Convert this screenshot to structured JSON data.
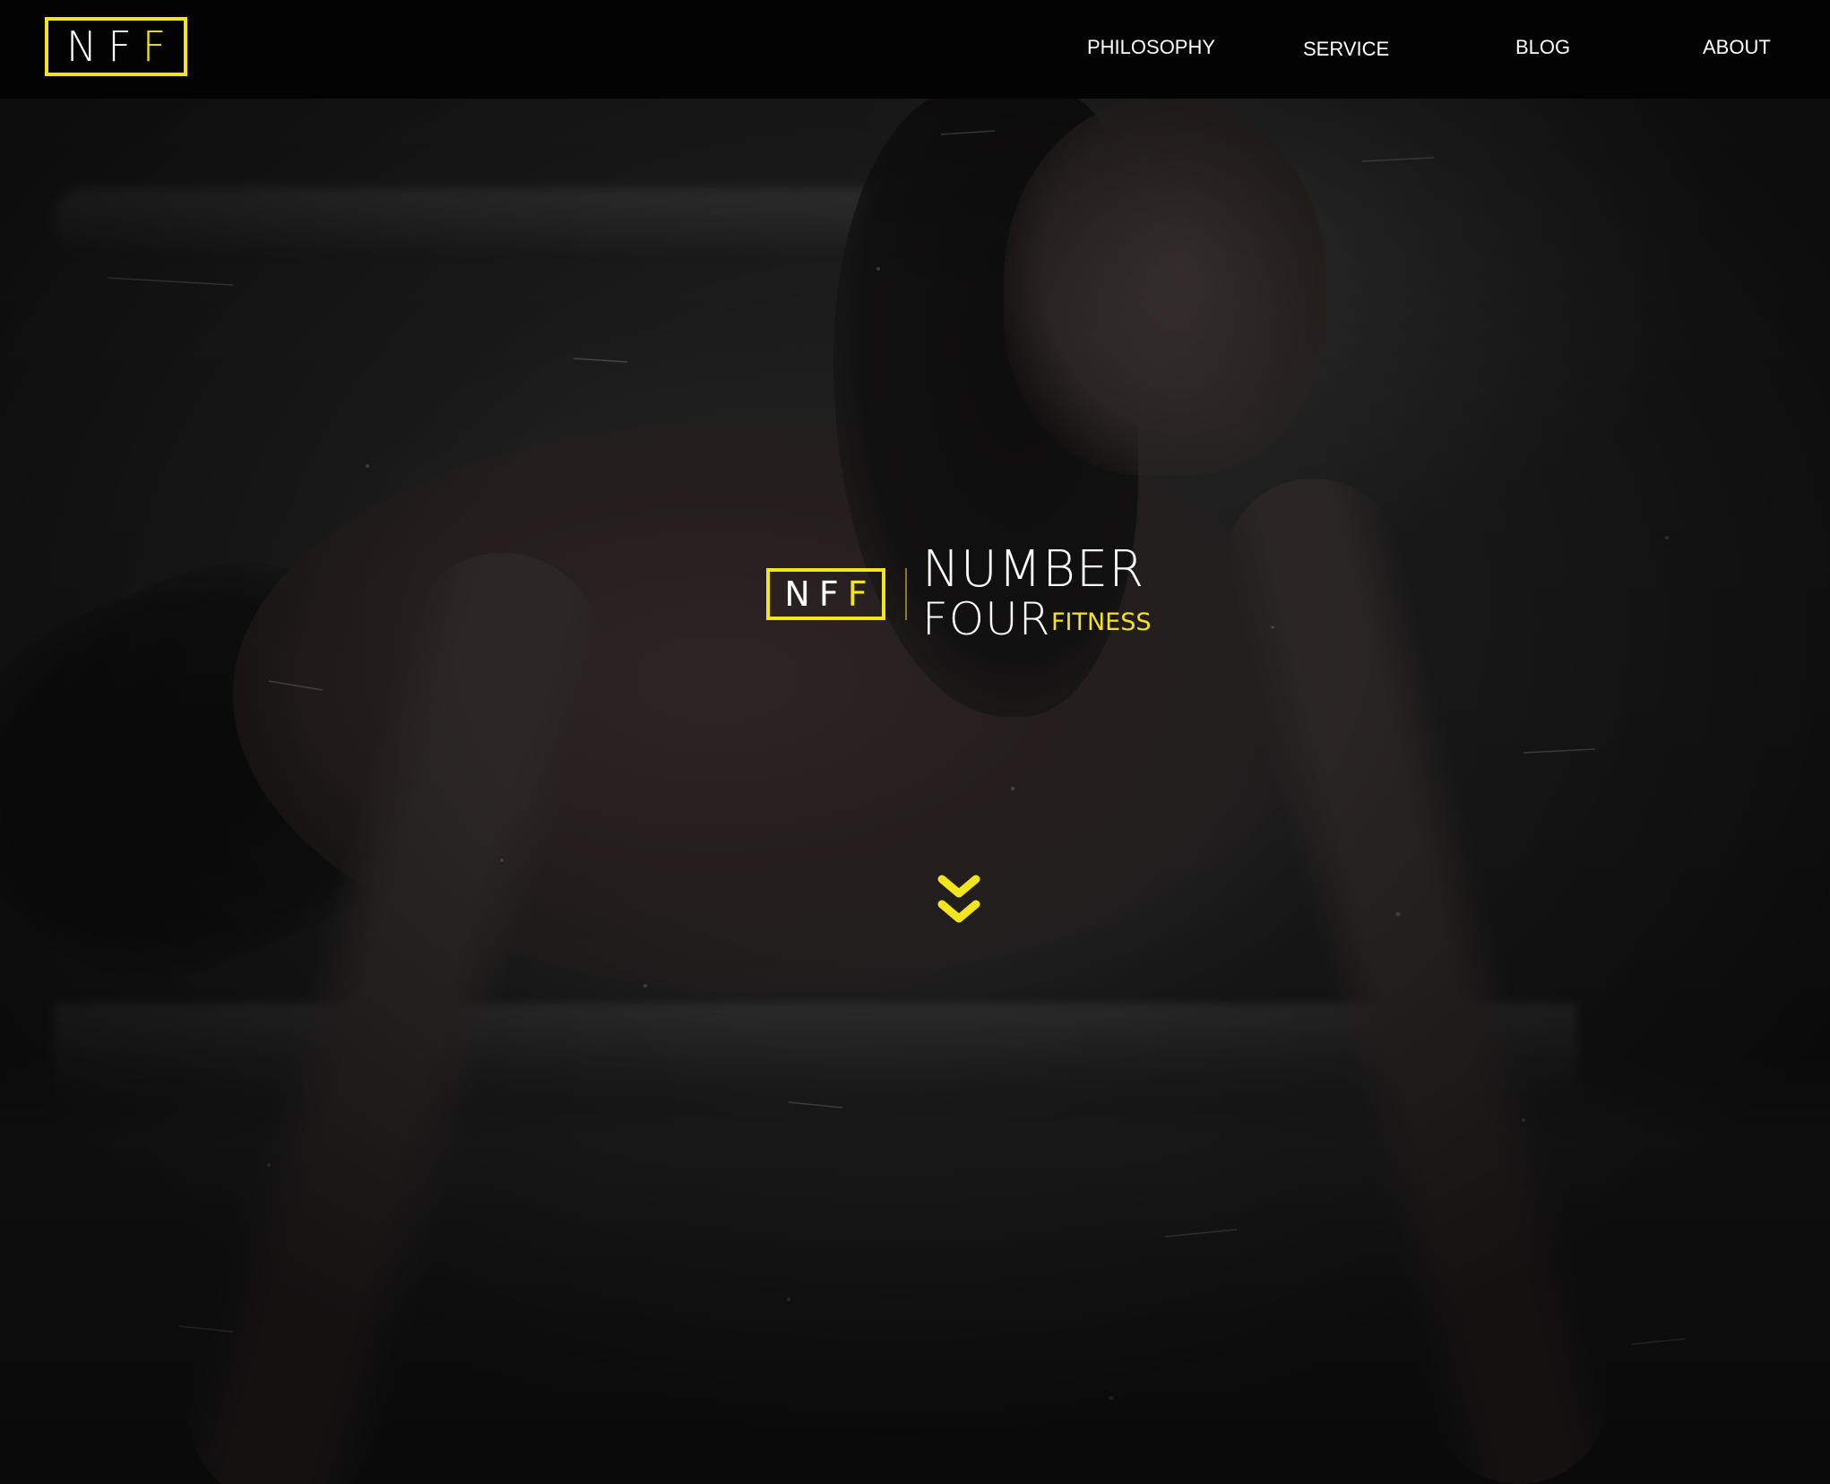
{
  "brand": {
    "logo_letters_main": "NF",
    "logo_letters_accent": "F",
    "hero_word_1": "NUMBER",
    "hero_word_2": "FOUR",
    "hero_word_3": "FITNESS"
  },
  "nav": {
    "items": [
      {
        "label": "PHILOSOPHY"
      },
      {
        "label": "SERVICE"
      },
      {
        "label": "BLOG"
      },
      {
        "label": "ABOUT"
      }
    ]
  },
  "hero": {
    "scroll_icon": "double-chevron-down-icon"
  },
  "colors": {
    "accent": "#f2e51c",
    "topbar": "#030303",
    "text": "#ffffff"
  }
}
